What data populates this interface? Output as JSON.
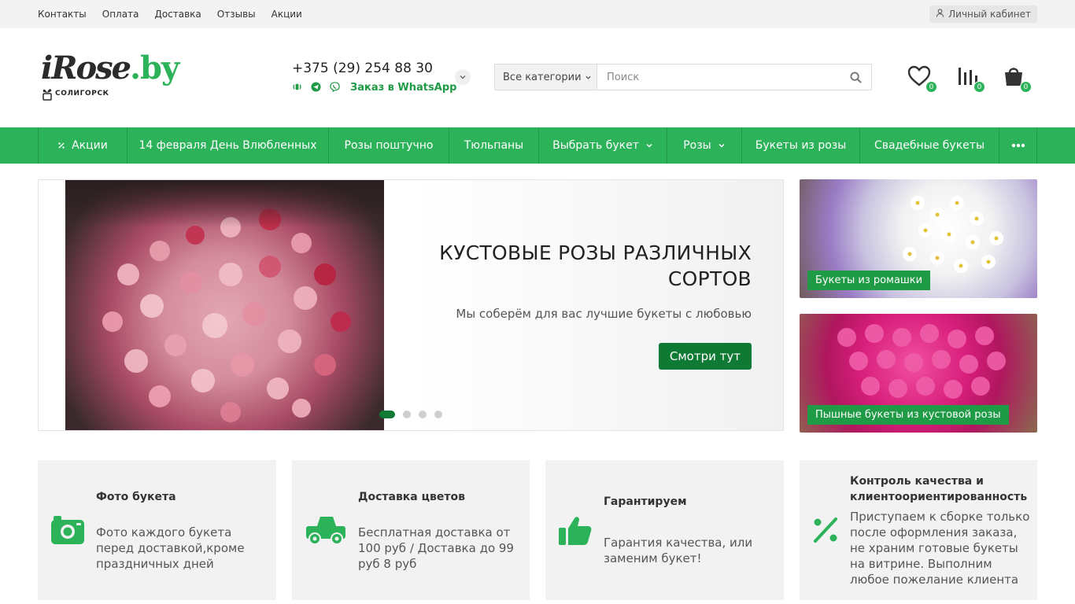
{
  "topbar": {
    "links": [
      "Контакты",
      "Оплата",
      "Доставка",
      "Отзывы",
      "Акции"
    ],
    "account": "Личный кабинет"
  },
  "header": {
    "logo_text": "iRose",
    "logo_domain": ".by",
    "logo_city": "СОЛИГОРСК",
    "phone": "+375 (29) 254 88 30",
    "whatsapp_label": "Заказ в WhatsApp",
    "search": {
      "category": "Все категории",
      "placeholder": "Поиск"
    },
    "counters": {
      "favorites": "0",
      "compare": "0",
      "cart": "0"
    }
  },
  "nav": {
    "items": [
      {
        "label": "Акции"
      },
      {
        "label": "14 февраля День Влюбленных"
      },
      {
        "label": "Розы поштучно"
      },
      {
        "label": "Тюльпаны"
      },
      {
        "label": "Выбрать букет"
      },
      {
        "label": "Розы"
      },
      {
        "label": "Букеты из розы"
      },
      {
        "label": "Свадебные букеты"
      }
    ]
  },
  "slider": {
    "title": "КУСТОВЫЕ РОЗЫ РАЗЛИЧНЫХ СОРТОВ",
    "subtitle": "Мы соберём для вас лучшие букеты с любовью",
    "button": "Смотри тут",
    "slides_count": 4,
    "active_slide": 1
  },
  "promos": [
    {
      "label": "Букеты из ромашки"
    },
    {
      "label": "Пышные букеты из кустовой розы"
    }
  ],
  "features": [
    {
      "icon": "camera-icon",
      "title": "Фото букета",
      "text": "Фото каждого букета перед доставкой,кроме праздничных дней"
    },
    {
      "icon": "truck-icon",
      "title": "Доставка цветов",
      "text": "Бесплатная доставка от 100 руб / Доставка до 99 руб 8 руб"
    },
    {
      "icon": "thumbs-up-icon",
      "title": "Гарантируем",
      "text": "Гарантия качества, или заменим букет!"
    },
    {
      "icon": "percent-icon",
      "title": "Контроль качества и клиентоориентированность",
      "text": "Приступаем к сборке только после оформления заказа, не храним готовые букеты на витрине. Выполним любое пожелание клиента"
    }
  ],
  "colors": {
    "accent": "#2cb35a",
    "button": "#0f7a34"
  }
}
